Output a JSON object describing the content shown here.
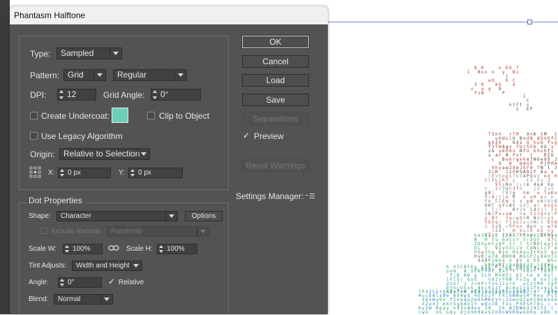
{
  "dialog": {
    "title": "Phantasm Halftone",
    "type_label": "Type:",
    "type_value": "Sampled",
    "pattern_label": "Pattern:",
    "pattern_value": "Grid",
    "pattern_style_value": "Regular",
    "dpi_label": "DPI:",
    "dpi_value": "12",
    "grid_angle_label": "Grid Angle:",
    "grid_angle_value": "0°",
    "create_undercoat_label": "Create Undercoat:",
    "undercoat_color": "#6fcfb6",
    "clip_label": "Clip to Object",
    "legacy_label": "Use Legacy Algorithm",
    "origin_label": "Origin:",
    "origin_value": "Relative to Selection",
    "x_label": "X:",
    "x_value": "0 px",
    "y_label": "Y:",
    "y_value": "0 px",
    "dot_properties": {
      "title": "Dot Properties",
      "shape_label": "Shape:",
      "shape_value": "Character",
      "options_label": "Options",
      "include_variants_label": "Include Variants",
      "variants_value": "Randomly",
      "scale_w_label": "Scale W:",
      "scale_w_value": "100%",
      "scale_h_label": "Scale H:",
      "scale_h_value": "100%",
      "tint_label": "Tint Adjusts:",
      "tint_value": "Width and Height",
      "angle_label": "Angle:",
      "angle_value": "0°",
      "relative_label": "Relative",
      "blend_label": "Blend:",
      "blend_value": "Normal"
    },
    "buttons": {
      "ok": "OK",
      "cancel": "Cancel",
      "load": "Load",
      "save": "Save",
      "separations": "Separations",
      "reset_warnings": "Reset Warnings"
    },
    "preview_label": "Preview",
    "settings_manager_label": "Settings Manager:"
  },
  "colors": {
    "dialog_bg": "#535353",
    "field_bg": "#414141",
    "selection_line": "#6b8ed6"
  }
}
